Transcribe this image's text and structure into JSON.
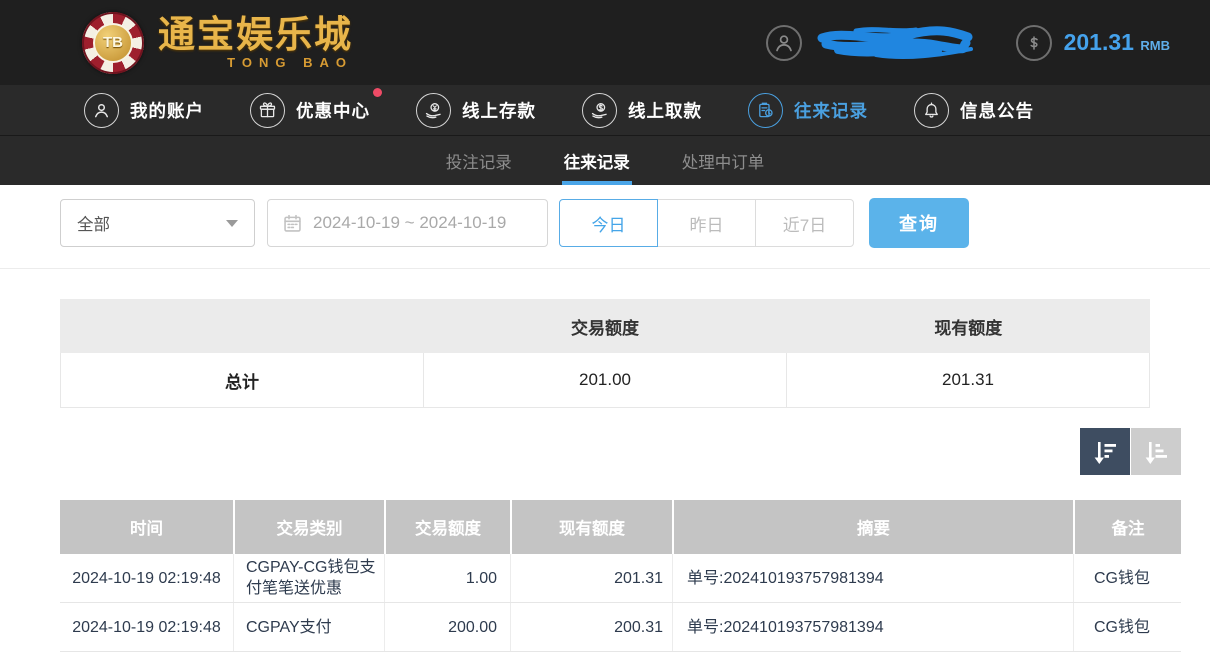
{
  "colors": {
    "accent": "#4aa6e8",
    "query_button": "#5bb3ea",
    "nav_active": "#4aa0e0",
    "notification_dot": "#ee4b66",
    "gold": "#e8b54a"
  },
  "header": {
    "logo": {
      "chip_text": "TB",
      "title": "通宝娱乐城",
      "subtitle": "TONG BAO"
    },
    "user": {
      "username_redacted": ""
    },
    "balance": {
      "amount": "201.31",
      "currency": "RMB"
    }
  },
  "nav": {
    "items": [
      {
        "label": "我的账户",
        "icon": "user-icon",
        "active": false,
        "badge": false
      },
      {
        "label": "优惠中心",
        "icon": "gift-icon",
        "active": false,
        "badge": true
      },
      {
        "label": "线上存款",
        "icon": "deposit-icon",
        "active": false,
        "badge": false
      },
      {
        "label": "线上取款",
        "icon": "withdraw-icon",
        "active": false,
        "badge": false
      },
      {
        "label": "往来记录",
        "icon": "records-icon",
        "active": true,
        "badge": false
      },
      {
        "label": "信息公告",
        "icon": "bell-icon",
        "active": false,
        "badge": false
      }
    ]
  },
  "subtabs": [
    {
      "label": "投注记录",
      "active": false
    },
    {
      "label": "往来记录",
      "active": true
    },
    {
      "label": "处理中订单",
      "active": false
    }
  ],
  "filters": {
    "type_select": {
      "value": "全部"
    },
    "date_range": {
      "value": "2024-10-19 ~ 2024-10-19"
    },
    "quick_buttons": [
      {
        "label": "今日",
        "active": true
      },
      {
        "label": "昨日",
        "active": false
      },
      {
        "label": "近7日",
        "active": false
      }
    ],
    "query_label": "查询"
  },
  "summary_table": {
    "headers": [
      "",
      "交易额度",
      "现有额度"
    ],
    "rows": [
      [
        "总计",
        "201.00",
        "201.31"
      ]
    ]
  },
  "sort": {
    "descending_active": true
  },
  "records_table": {
    "headers": [
      "时间",
      "交易类别",
      "交易额度",
      "现有额度",
      "摘要",
      "备注"
    ],
    "rows": [
      [
        "2024-10-19 02:19:48",
        "CGPAY-CG钱包支付笔笔送优惠",
        "1.00",
        "201.31",
        "单号:202410193757981394",
        "CG钱包"
      ],
      [
        "2024-10-19 02:19:48",
        "CGPAY支付",
        "200.00",
        "200.31",
        "单号:202410193757981394",
        "CG钱包"
      ]
    ]
  },
  "icons": {
    "user-icon": "person outline in circle",
    "gift-icon": "gift box in circle",
    "deposit-icon": "hand holding coin in circle",
    "withdraw-icon": "hand holding dollar coin in circle",
    "records-icon": "clipboard with clock in circle",
    "bell-icon": "bell in circle",
    "avatar-icon": "person outline in circle",
    "dollar-circle-icon": "dollar sign in circle",
    "calendar-icon": "calendar grid",
    "caret-down-icon": "down triangle",
    "sort-desc-icon": "arrow down with descending bars",
    "sort-asc-icon": "arrow down with ascending bars",
    "username-scribble": "blue marker scribble redacting username"
  }
}
